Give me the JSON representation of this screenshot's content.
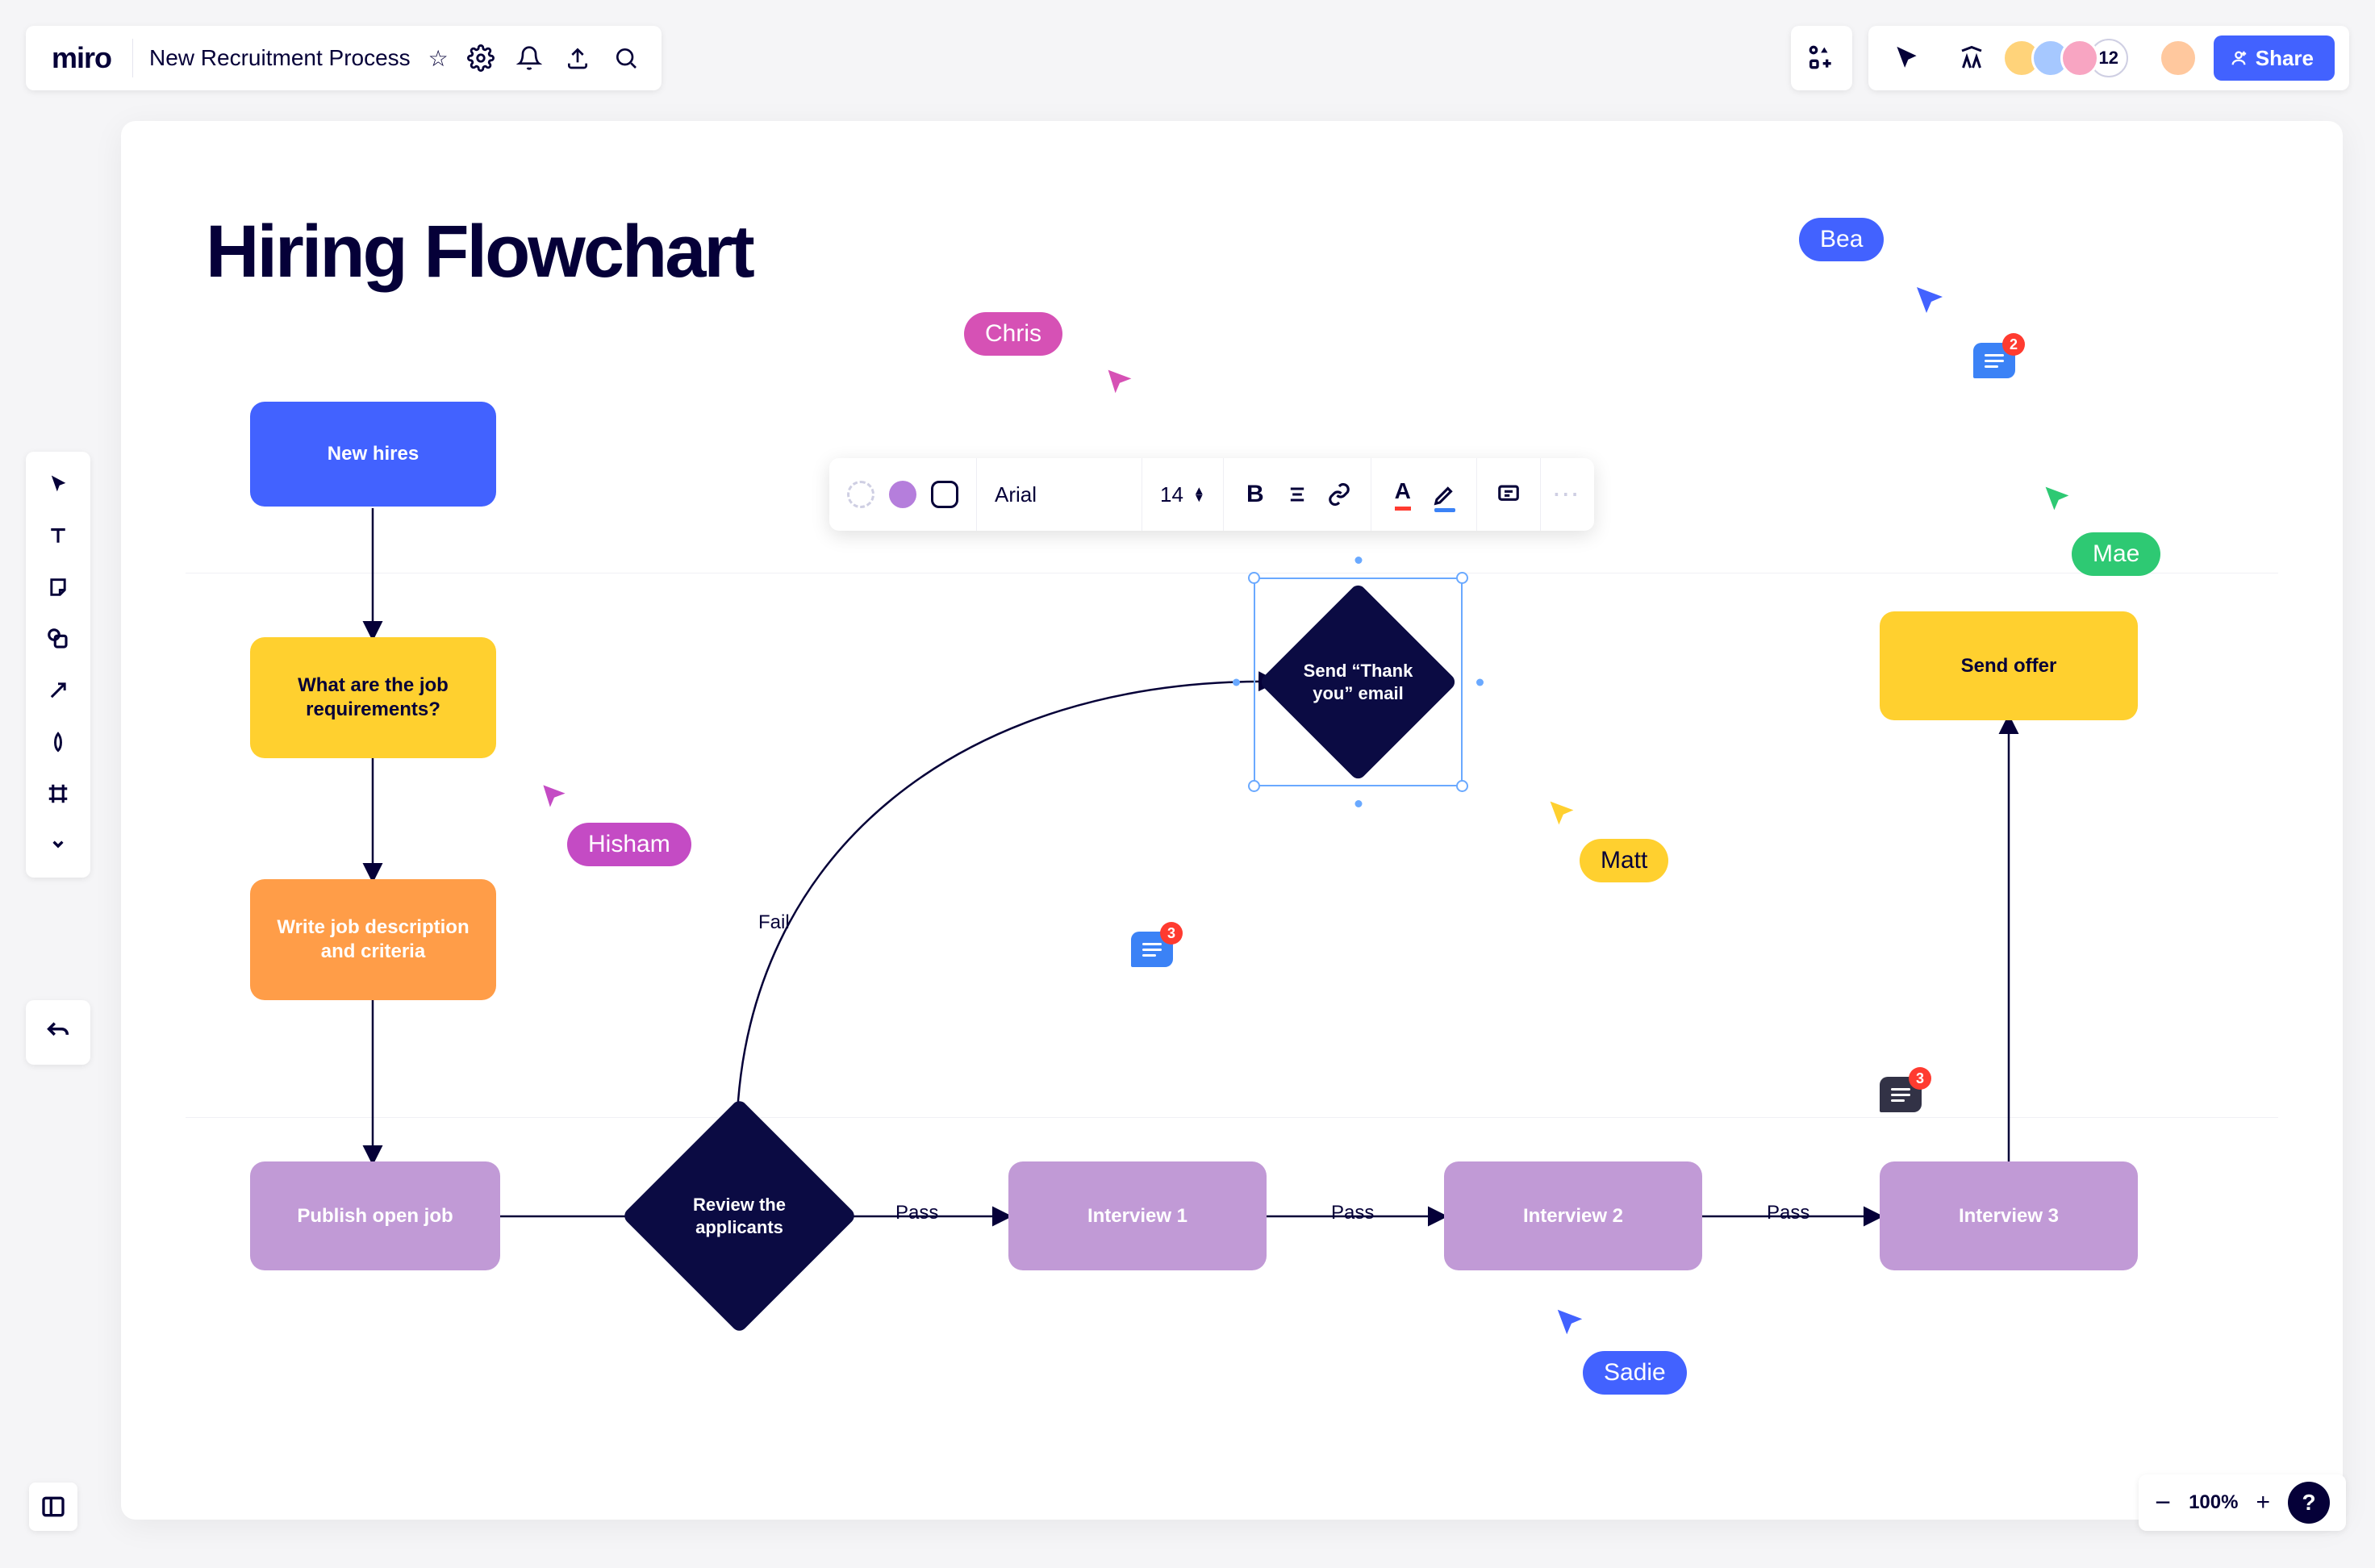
{
  "brand": "miro",
  "file": {
    "name": "New Recruitment Process"
  },
  "share": "Share",
  "avatar_overflow": "12",
  "board_title": "Hiring Flowchart",
  "nodes": {
    "n1": "New hires",
    "n2": "What are the job requirements?",
    "n3": "Write job description and criteria",
    "n4": "Publish open job",
    "n5": "Review the applicants",
    "n6": "Interview 1",
    "n7": "Interview 2",
    "n8": "Interview 3",
    "n9": "Send “Thank you” email",
    "n10": "Send offer"
  },
  "edges": {
    "fail": "Fail",
    "pass1": "Pass",
    "pass2": "Pass",
    "pass3": "Pass"
  },
  "ctx": {
    "font": "Arial",
    "size": "14"
  },
  "cursors": {
    "chris": "Chris",
    "hisham": "Hisham",
    "bea": "Bea",
    "mae": "Mae",
    "matt": "Matt",
    "sadie": "Sadie"
  },
  "comments": {
    "c1": "3",
    "c2": "2",
    "c3": "3"
  },
  "zoom": "100%"
}
